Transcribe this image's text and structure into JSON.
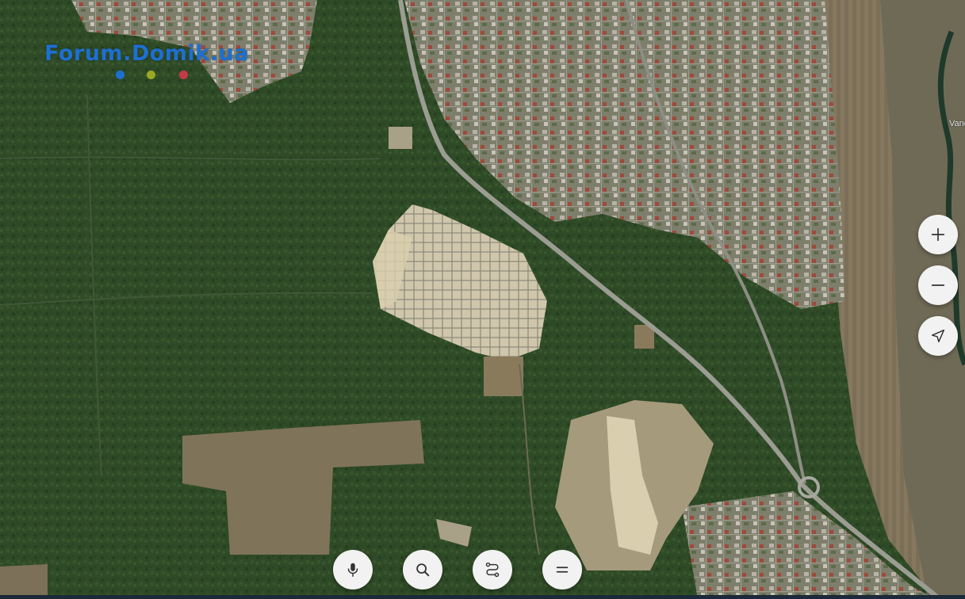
{
  "watermark": {
    "text": "Forum.Domik.ua",
    "dot_colors": [
      "#1d6fd1",
      "#9aa821",
      "#c63a4a"
    ]
  },
  "map": {
    "type": "satellite",
    "place_label": "Vand"
  },
  "controls": {
    "zoom_in_icon": "plus-icon",
    "zoom_out_icon": "minus-icon",
    "locate_icon": "navigation-arrow-icon",
    "voice_icon": "microphone-icon",
    "search_icon": "magnifier-icon",
    "routes_icon": "route-icon",
    "menu_icon": "menu-icon"
  },
  "colors": {
    "forest": "#2f4a26",
    "clearing": "#8a7a5c",
    "sand": "#d9cfae",
    "button_bg": "#f2f2f2",
    "icon": "#333333"
  }
}
